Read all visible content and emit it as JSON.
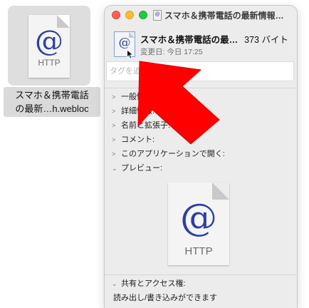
{
  "desktop_file": {
    "icon_label": "HTTP",
    "name_line1": "スマホ＆携帯電話",
    "name_line2": "の最新…h.webloc"
  },
  "window": {
    "title": "スマホ＆携帯電話の最新情報…",
    "file_name": "スマホ＆携帯電話の最…",
    "file_size": "373 バイト",
    "modified": "変更日: 今日 17:25",
    "tags_placeholder": "タグを追加..."
  },
  "sections": [
    {
      "label": "一般情報:",
      "expanded": false
    },
    {
      "label": "詳細情報:",
      "expanded": false
    },
    {
      "label": "名前と拡張子:",
      "expanded": false
    },
    {
      "label": "コメント:",
      "expanded": false
    },
    {
      "label": "このアプリケーションで開く:",
      "expanded": false
    },
    {
      "label": "プレビュー:",
      "expanded": true
    }
  ],
  "preview": {
    "icon_label": "HTTP"
  },
  "sharing": {
    "label": "共有とアクセス権:",
    "permission_text": "読み出し/書き込みができます"
  },
  "colors": {
    "arrow": "#ff0000",
    "close": "#fe5f57",
    "minimize": "#febc2e",
    "zoom": "#28c840",
    "at_symbol": "#2d3fa3"
  }
}
